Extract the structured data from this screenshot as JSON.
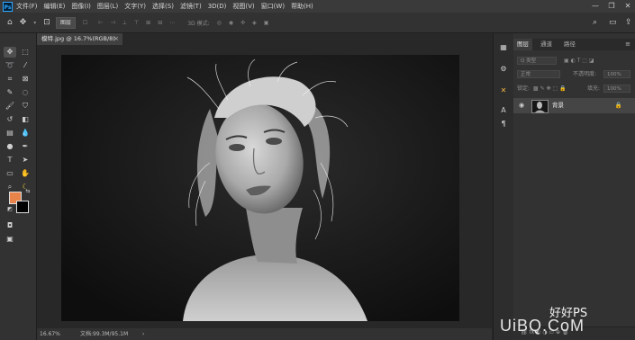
{
  "menubar": {
    "app_logo": "Ps",
    "items": [
      "文件(F)",
      "编辑(E)",
      "图像(I)",
      "图层(L)",
      "文字(Y)",
      "选择(S)",
      "滤镜(T)",
      "3D(D)",
      "视图(V)",
      "窗口(W)",
      "帮助(H)"
    ],
    "window_controls": {
      "minimize": "—",
      "maximize": "❐",
      "close": "✕"
    }
  },
  "options": {
    "mode_label": "图层",
    "mode_3d": "3D 模式:",
    "icons": [
      "home-icon",
      "move-icon",
      "auto-select-icon",
      "align-icon",
      "3d-mode-icon",
      "search-icon",
      "workspace-icon",
      "share-icon"
    ]
  },
  "document": {
    "tab_label": "模特.jpg @ 16.7%(RGB/8)",
    "tab_close": "×"
  },
  "status": {
    "zoom": "16.67%",
    "doc_size": "文档:99.3M/95.1M",
    "arrow": "›"
  },
  "panels": {
    "tabs": [
      "图层",
      "通道",
      "路径"
    ],
    "active_tab": "图层",
    "menu": "≡",
    "kind_label": "Q 类型",
    "blend_mode": "正常",
    "opacity_label": "不透明度:",
    "opacity_value": "100%",
    "lock_label": "锁定:",
    "fill_label": "填充:",
    "fill_value": "100%"
  },
  "layer": {
    "name": "背景",
    "visibility": "◉",
    "lock_icon": "🔒"
  },
  "colors": {
    "foreground": "#e8844a",
    "background": "#000000",
    "accent": "#31a8ff"
  },
  "watermark": {
    "text": "好好PS",
    "logo": "UiBQ.CoM"
  }
}
